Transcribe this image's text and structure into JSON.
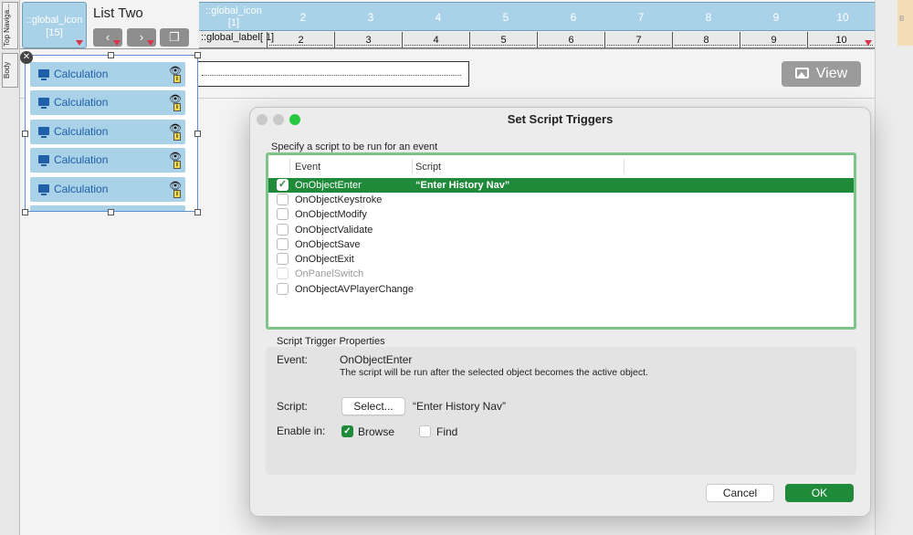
{
  "layout_parts": {
    "top": "Top Naviga...",
    "body": "Body"
  },
  "header": {
    "global_icon_tile": "::global_icon [15]",
    "list_title": "List Two",
    "portal_header_first": "::global_icon [1]",
    "portal_header_numbers": [
      "2",
      "3",
      "4",
      "5",
      "6",
      "7",
      "8",
      "9",
      "10"
    ],
    "portal_label_first": "::global_label[ 1]",
    "portal_label_numbers": [
      "2",
      "3",
      "4",
      "5",
      "6",
      "7",
      "8",
      "9",
      "10"
    ],
    "right_tab": "B"
  },
  "view_button": {
    "label": "View",
    "icon": "image-icon"
  },
  "portal_list": {
    "rows": [
      {
        "label": "Calculation"
      },
      {
        "label": "Calculation"
      },
      {
        "label": "Calculation"
      },
      {
        "label": "Calculation"
      },
      {
        "label": "Calculation"
      }
    ]
  },
  "dialog": {
    "title": "Set Script Triggers",
    "specify_label": "Specify a script to be run for an event",
    "columns": {
      "event": "Event",
      "script": "Script"
    },
    "events": [
      {
        "event": "OnObjectEnter",
        "script": "“Enter History Nav”",
        "checked": true,
        "selected": true
      },
      {
        "event": "OnObjectKeystroke",
        "script": "",
        "checked": false
      },
      {
        "event": "OnObjectModify",
        "script": "",
        "checked": false
      },
      {
        "event": "OnObjectValidate",
        "script": "",
        "checked": false
      },
      {
        "event": "OnObjectSave",
        "script": "",
        "checked": false
      },
      {
        "event": "OnObjectExit",
        "script": "",
        "checked": false
      },
      {
        "event": "OnPanelSwitch",
        "script": "",
        "checked": false,
        "disabled": true
      },
      {
        "event": "OnObjectAVPlayerChange",
        "script": "",
        "checked": false
      }
    ],
    "properties": {
      "section_label": "Script Trigger Properties",
      "event_label": "Event:",
      "event_value": "OnObjectEnter",
      "event_description": "The script will be run after the selected object becomes the active object.",
      "script_label": "Script:",
      "select_button": "Select...",
      "script_value": "“Enter History Nav”",
      "enable_label": "Enable in:",
      "browse_label": "Browse",
      "browse_checked": true,
      "find_label": "Find",
      "find_checked": false
    },
    "buttons": {
      "cancel": "Cancel",
      "ok": "OK"
    }
  },
  "colors": {
    "accent_green": "#1f8a3a",
    "tile_blue": "#a9d1e8",
    "link_blue": "#1f5ea8",
    "traffic_close": "#c9c9c9",
    "traffic_min": "#c9c9c9",
    "traffic_max": "#28c840"
  }
}
